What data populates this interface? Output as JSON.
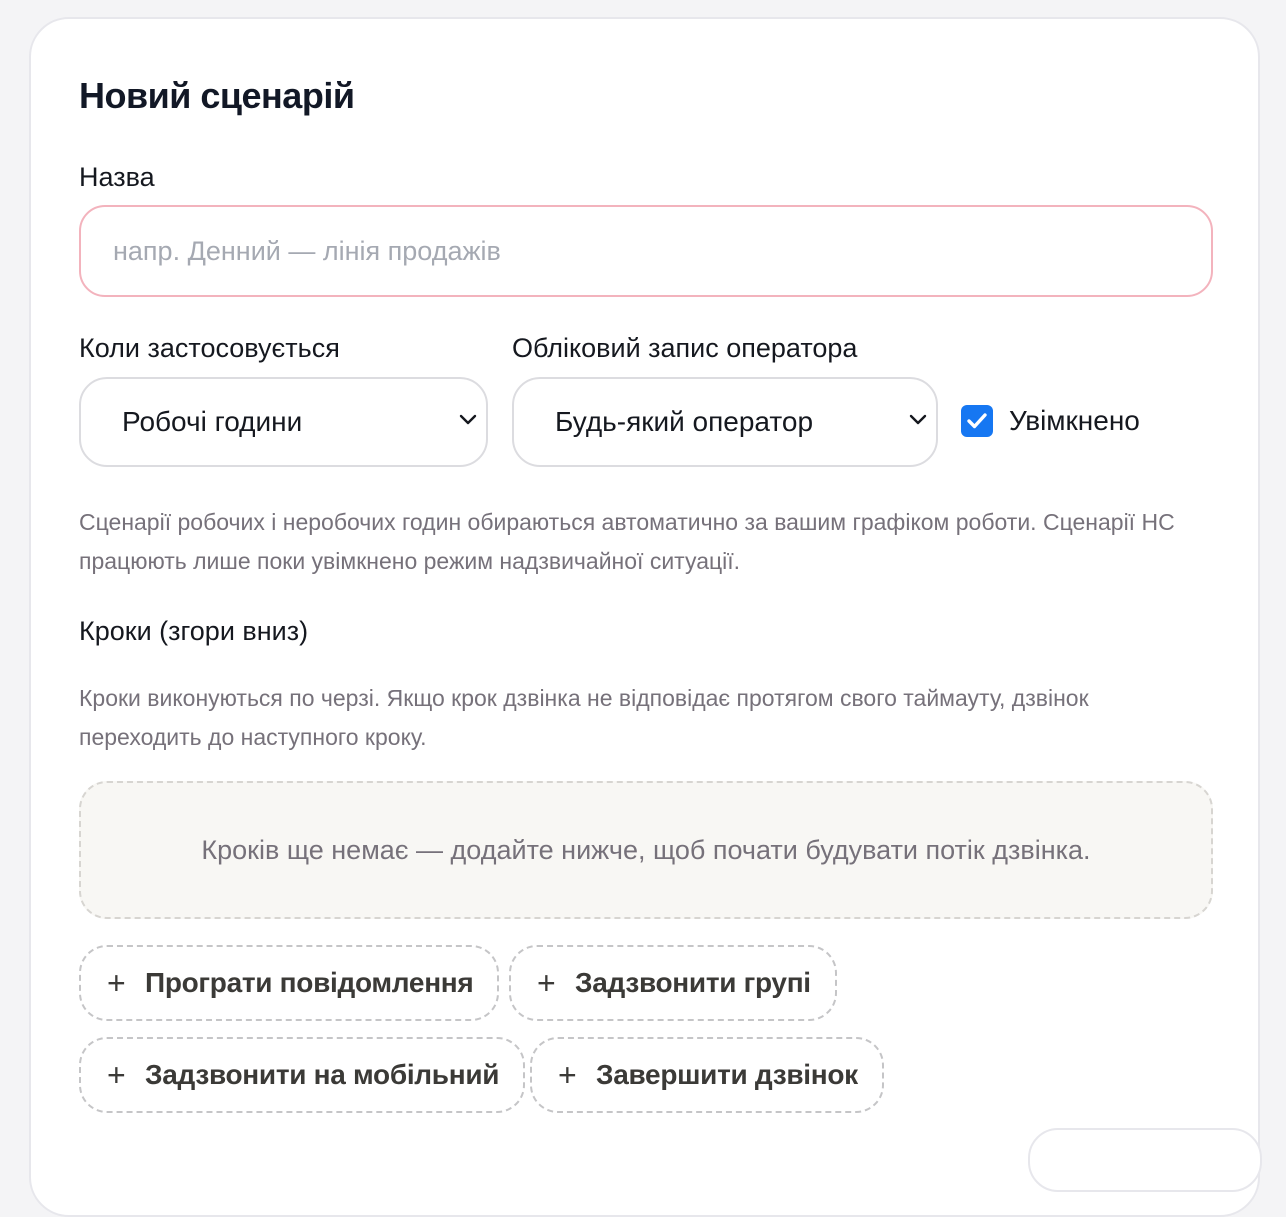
{
  "form": {
    "title": "Новий сценарій",
    "name_label": "Назва",
    "name_value": "",
    "name_placeholder": "напр. Денний — лінія продажів",
    "when_label": "Коли застосовується",
    "when_value": "Робочі години",
    "operator_label": "Обліковий запис оператора",
    "operator_value": "Будь-який оператор",
    "enabled_label": "Увімкнено",
    "enabled_checked": true,
    "help_text": "Сценарії робочих і неробочих годин обираються автоматично за вашим графіком роботи. Сценарії НС працюють лише поки увімкнено режим надзвичайної ситуації.",
    "steps_label": "Кроки (згори вниз)",
    "steps_help": "Кроки виконуються по черзі. Якщо крок дзвінка не відповідає протягом свого таймауту, дзвінок переходить до наступного кроку.",
    "steps_empty": "Кроків ще немає — додайте нижче, щоб почати будувати потік дзвінка."
  },
  "add_buttons": {
    "plus": "+",
    "play_message": "Програти повідомлення",
    "call_group": "Задзвонити групі",
    "call_mobile": "Задзвонити на мобільний",
    "end_call": "Завершити дзвінок"
  },
  "colors": {
    "accent": "#1677f2",
    "input_error_border": "#f3b3bd",
    "muted_text": "#76717a"
  }
}
